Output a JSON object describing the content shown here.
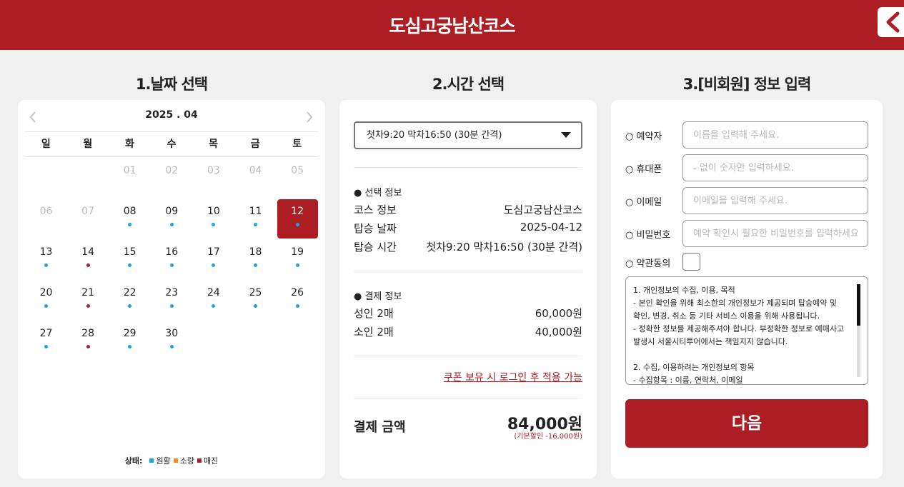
{
  "header": {
    "title": "도심고궁남산코스"
  },
  "sections": {
    "date": "1.날짜 선택",
    "time": "2.시간 선택",
    "info": "3.[비회원] 정보 입력"
  },
  "calendar": {
    "month": "2025 . 04",
    "weekdays": [
      "일",
      "월",
      "화",
      "수",
      "목",
      "금",
      "토"
    ],
    "days": [
      {
        "n": "01",
        "col": 2,
        "row": 0,
        "state": "disabled"
      },
      {
        "n": "02",
        "col": 3,
        "row": 0,
        "state": "disabled"
      },
      {
        "n": "03",
        "col": 4,
        "row": 0,
        "state": "disabled"
      },
      {
        "n": "04",
        "col": 5,
        "row": 0,
        "state": "disabled"
      },
      {
        "n": "05",
        "col": 6,
        "row": 0,
        "state": "disabled"
      },
      {
        "n": "06",
        "col": 0,
        "row": 1,
        "state": "disabled"
      },
      {
        "n": "07",
        "col": 1,
        "row": 1,
        "state": "disabled"
      },
      {
        "n": "08",
        "col": 2,
        "row": 1,
        "state": "available"
      },
      {
        "n": "09",
        "col": 3,
        "row": 1,
        "state": "available"
      },
      {
        "n": "10",
        "col": 4,
        "row": 1,
        "state": "available"
      },
      {
        "n": "11",
        "col": 5,
        "row": 1,
        "state": "available"
      },
      {
        "n": "12",
        "col": 6,
        "row": 1,
        "state": "available",
        "selected": true
      },
      {
        "n": "13",
        "col": 0,
        "row": 2,
        "state": "available"
      },
      {
        "n": "14",
        "col": 1,
        "row": 2,
        "state": "soldout"
      },
      {
        "n": "15",
        "col": 2,
        "row": 2,
        "state": "available"
      },
      {
        "n": "16",
        "col": 3,
        "row": 2,
        "state": "available"
      },
      {
        "n": "17",
        "col": 4,
        "row": 2,
        "state": "available"
      },
      {
        "n": "18",
        "col": 5,
        "row": 2,
        "state": "available"
      },
      {
        "n": "19",
        "col": 6,
        "row": 2,
        "state": "available"
      },
      {
        "n": "20",
        "col": 0,
        "row": 3,
        "state": "available"
      },
      {
        "n": "21",
        "col": 1,
        "row": 3,
        "state": "soldout"
      },
      {
        "n": "22",
        "col": 2,
        "row": 3,
        "state": "available"
      },
      {
        "n": "23",
        "col": 3,
        "row": 3,
        "state": "available"
      },
      {
        "n": "24",
        "col": 4,
        "row": 3,
        "state": "available"
      },
      {
        "n": "25",
        "col": 5,
        "row": 3,
        "state": "available"
      },
      {
        "n": "26",
        "col": 6,
        "row": 3,
        "state": "available"
      },
      {
        "n": "27",
        "col": 0,
        "row": 4,
        "state": "available"
      },
      {
        "n": "28",
        "col": 1,
        "row": 4,
        "state": "soldout"
      },
      {
        "n": "29",
        "col": 2,
        "row": 4,
        "state": "available"
      },
      {
        "n": "30",
        "col": 3,
        "row": 4,
        "state": "available"
      }
    ],
    "legend": {
      "title": "상태:",
      "items": [
        {
          "label": "원활",
          "color": "#1aa3e8"
        },
        {
          "label": "소량",
          "color": "#f28a1c"
        },
        {
          "label": "매진",
          "color": "#a32424"
        }
      ]
    },
    "status_colors": {
      "available": "#1aa3e8",
      "soldout": "#a32424"
    }
  },
  "time": {
    "selected": "첫차9:20 막차16:50 (30분 간격)",
    "selection_title": "● 선택 정보",
    "course_label": "코스 정보",
    "course_value": "도심고궁남산코스",
    "date_label": "탑승 날짜",
    "date_value": "2025-04-12",
    "time_label": "탑승 시간",
    "time_value": "첫차9:20 막차16:50 (30분 간격)",
    "payment_title": "● 결제 정보",
    "adult_label": "성인 2매",
    "adult_price": "60,000원",
    "child_label": "소인 2매",
    "child_price": "40,000원",
    "coupon": "쿠폰 보유 시 로그인 후 적용 가능",
    "total_label": "결제 금액",
    "total_amount": "84,000원",
    "discount": "(기본할인 -16,000원)"
  },
  "form": {
    "name_label": "○ 예약자",
    "name_placeholder": "이름을 입력해 주세요.",
    "phone_label": "○ 휴대폰",
    "phone_placeholder": "- 없이 숫자만 입력하세요.",
    "email_label": "○ 이메일",
    "email_placeholder": "이메일을 입력해 주세요.",
    "password_label": "○ 비밀번호",
    "password_placeholder": "예약 확인시 필요한 비밀번호를 입력하세요",
    "agree_label": "○ 약관동의",
    "terms": [
      "1. 개인정보의 수집, 이용, 목적",
      "- 본인 확인을 위해 최소한의 개인정보가 제공되며 탑승예약 및",
      "확인, 변경, 취소 등 기타 서비스 이용을 위해 사용됩니다.",
      "- 정확한 정보를 제공해주셔야 합니다. 부정확한 정보로 예매사고",
      "발생시 서울시티투어에서는 책임지지 않습니다.",
      "",
      "2. 수집, 이용하려는 개인정보의 항목",
      "- 수집항목 : 이름, 연락처, 이메일"
    ],
    "next_button": "다음"
  }
}
